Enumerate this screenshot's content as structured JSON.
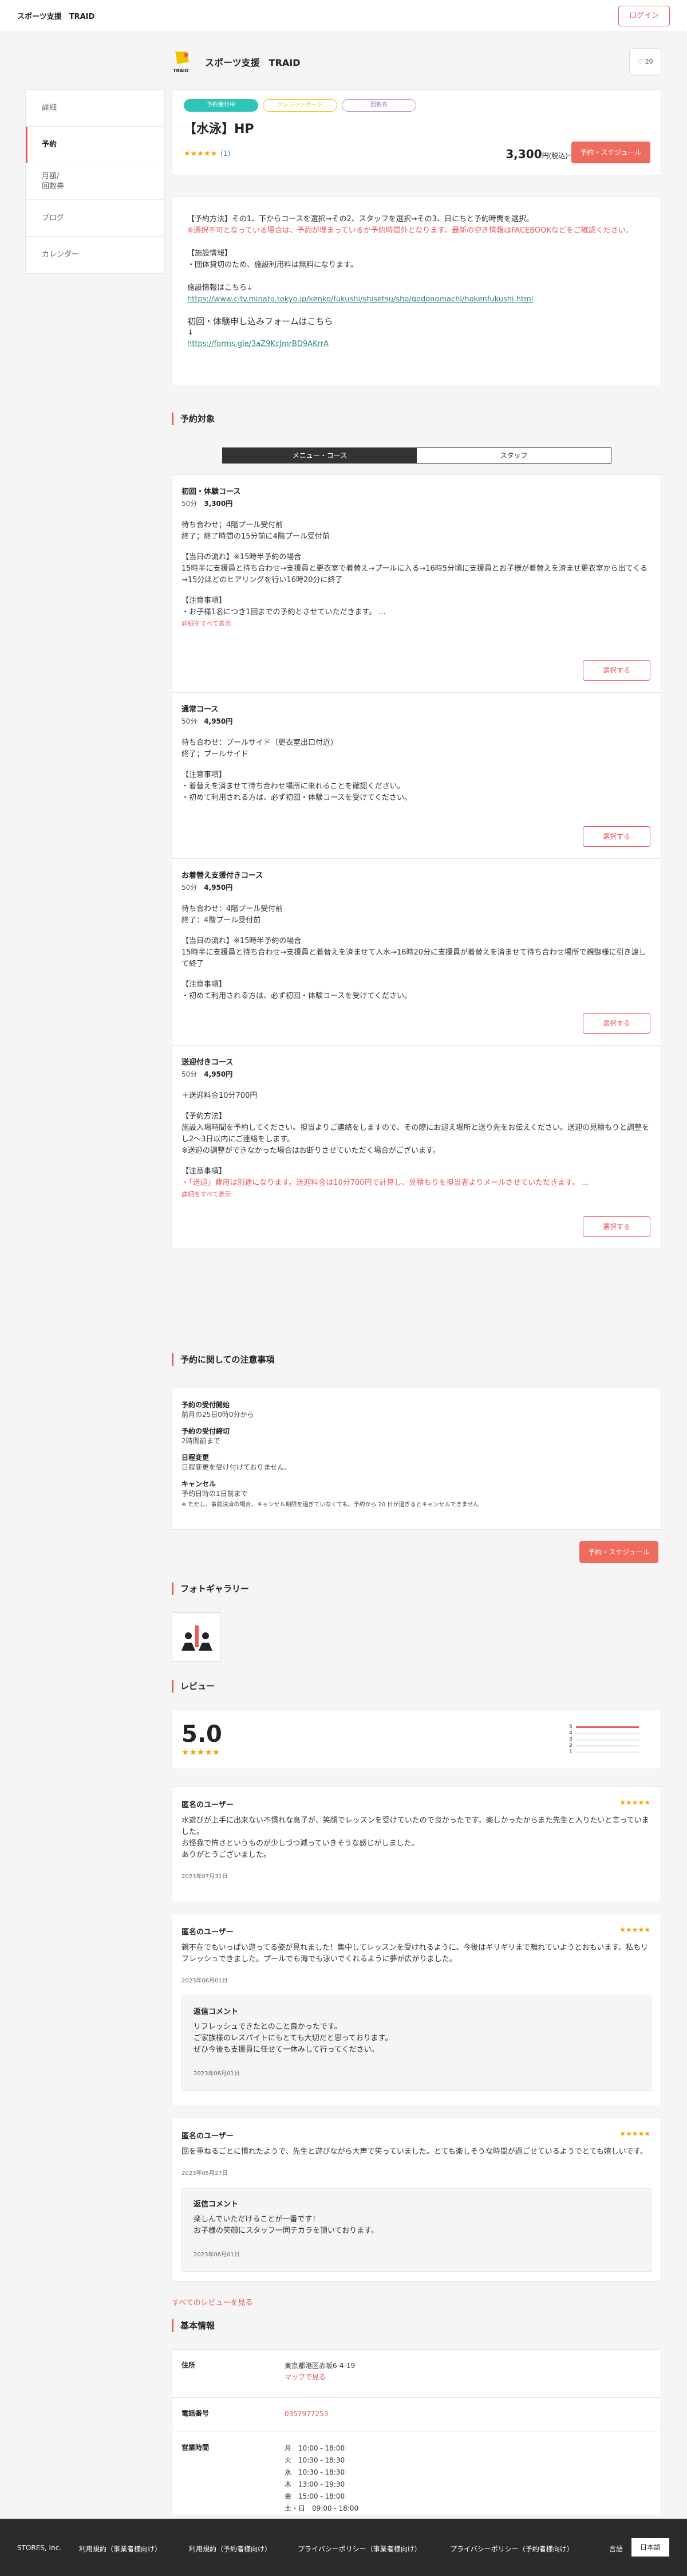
{
  "header": {
    "brand": "スポーツ支援　TRAID",
    "login": "ログイン"
  },
  "store": {
    "name": "スポーツ支援　TRAID",
    "logo_text": "TRAID",
    "fav_count": "20"
  },
  "sidebar": {
    "items": [
      {
        "label": "詳細"
      },
      {
        "label": "予約"
      },
      {
        "label": "月額/\n回数券"
      },
      {
        "label": "ブログ"
      },
      {
        "label": "カレンダー"
      }
    ]
  },
  "summary": {
    "tags": [
      "予約受付中",
      "クレジットカード",
      "回数券"
    ],
    "title": "【水泳】HP",
    "stars": "★★★★★",
    "count": "(1)",
    "price": "3,300",
    "price_unit": "円(税込)〜",
    "reserve": "予約・スケジュール"
  },
  "info": {
    "p1": "【予約方法】その1、下からコースを選択→その2、スタッフを選択→その3、日にちと予約時間を選択。",
    "p2": "※選択不可となっている場合は、予約が埋まっているか予約時間外となります。最新の空き情報はFACEBOOKなどをご確認ください。",
    "p3": "【施設情報】",
    "p4": "・団体貸切のため、施設利用料は無料になります。",
    "p5": "施設情報はこちら↓",
    "link1": "https://www.city.minato.tokyo.jp/kenko/fukushi/shisetsu/sho/godonomachi/hokenfukushi.html",
    "p6": "初回・体験申し込みフォームはこちら",
    "p7": "↓",
    "link2": "https://forms.gle/3aZ9KcJmrBD9AKrrA"
  },
  "sections": {
    "reserve_target": "予約対象",
    "notes": "予約に関しての注意事項",
    "gallery": "フォトギャラリー",
    "review": "レビュー",
    "basic": "基本情報"
  },
  "toggle": {
    "left": "メニュー・コース",
    "right": "スタッフ"
  },
  "menus": [
    {
      "name": "初回・体験コース",
      "duration": "50分",
      "price": "3,300円",
      "lines": [
        "待ち合わせ；4階プール受付前",
        "終了；終了時間の15分前に4階プール受付前",
        "",
        "【当日の流れ】※15時半予約の場合",
        "15時半に支援員と待ち合わせ→支援員と更衣室で着替え→プールに入る→16時5分頃に支援員とお子様が着替えを済ませ更衣室から出てくる→15分ほどのヒアリングを行い16時20分に終了",
        "",
        "【注意事項】",
        "・お子様1名につき1回までの予約とさせていただきます。 ..."
      ],
      "more": "詳細をすべて表示",
      "button": "選択する"
    },
    {
      "name": "通常コース",
      "duration": "50分",
      "price": "4,950円",
      "lines": [
        "待ち合わせ：プールサイド（更衣室出口付近）",
        "終了；プールサイド",
        "",
        "【注意事項】",
        "・着替えを済ませて待ち合わせ場所に来れることを確認ください。",
        "・初めて利用される方は、必ず初回・体験コースを受けてください。"
      ],
      "more": "",
      "button": "選択する"
    },
    {
      "name": "お着替え支援付きコース",
      "duration": "50分",
      "price": "4,950円",
      "lines": [
        "待ち合わせ：4階プール受付前",
        "終了：4階プール受付前",
        "",
        "【当日の流れ】※15時半予約の場合",
        "15時半に支援員と待ち合わせ→支援員と着替えを済ませて入水→16時20分に支援員が着替えを済ませて待ち合わせ場所で親御様に引き渡して終了",
        "",
        "【注意事項】",
        "・初めて利用される方は、必ず初回・体験コースを受けてください。"
      ],
      "more": "",
      "button": "選択する"
    },
    {
      "name": "送迎付きコース",
      "duration": "50分",
      "price": "4,950円",
      "lines": [
        "＋送迎料金10分700円",
        "",
        "【予約方法】",
        "施設入場時間を予約してください。担当よりご連絡をしますので、その際にお迎え場所と送り先をお伝えください。送迎の見積もりと調整をし2〜3日以内にご連絡をします。",
        "※送迎の調整ができなかった場合はお断りさせていただく場合がございます。",
        "",
        "【注意事項】",
        "・「送迎」費用は別途になります。送迎料金は10分700円で計算し、見積もりを担当者よりメールさせていただきます。 ..."
      ],
      "more": "詳細をすべて表示",
      "button": "選択する"
    }
  ],
  "notes": {
    "items": [
      {
        "h": "予約の受付開始",
        "v": "前月の25日0時0分から"
      },
      {
        "h": "予約の受付締切",
        "v": "2時間前まで"
      },
      {
        "h": "日程変更",
        "v": "日程変更を受け付けておりません。"
      },
      {
        "h": "キャンセル",
        "v": "予約日時の1日前まで"
      }
    ],
    "small": "※ ただし、事前決済の場合、キャンセル期限を過ぎていなくても、予約から 20 日が過ぎるとキャンセルできません",
    "button": "予約・スケジュール"
  },
  "review_summary": {
    "score": "5.0",
    "stars": "★★★★★",
    "bars": [
      {
        "label": "5",
        "value": 1
      },
      {
        "label": "4",
        "value": 0
      },
      {
        "label": "3",
        "value": 0
      },
      {
        "label": "2",
        "value": 0
      },
      {
        "label": "1",
        "value": 0
      }
    ]
  },
  "reviews": [
    {
      "who": "匿名のユーザー",
      "stars": "★★★★★",
      "body": "水遊びが上手に出来ない不慣れな息子が、笑顔でレッスンを受けていたので良かったです。楽しかったからまた先生と入りたいと言っていました。\nお怪我で怖さというものが少しづつ減っていきそうな感じがしました。\nありがとうございました。",
      "date": "2023年07月31日",
      "reply": null
    },
    {
      "who": "匿名のユーザー",
      "stars": "★★★★★",
      "body": "親不在でもいっぱい遊ってる姿が見れました！集中してレッスンを受けれるように、今後はギリギリまで離れていようとおもいます。私もリフレッシュできました。プールでも海でも泳いでくれるように夢が広がりました。",
      "date": "2023年06月01日",
      "reply": {
        "title": "返信コメント",
        "body": "リフレッシュできたとのこと良かったです。\nご家族様のレスパイトにもとても大切だと思っております。\nぜひ今後も支援員に任せて一休みして行ってください。",
        "date": "2023年06月01日"
      }
    },
    {
      "who": "匿名のユーザー",
      "stars": "★★★★★",
      "body": "回を重ねるごとに慣れたようで、先生と遊びながら大声で笑っていました。とても楽しそうな時間が過ごせているようでとても嬉しいです。",
      "date": "2023年05月27日",
      "reply": {
        "title": "返信コメント",
        "body": "楽しんでいただけることが一番です！\nお子様の笑顔にスタッフ一同テカラを頂いております。",
        "date": "2023年06月01日"
      }
    }
  ],
  "all_reviews": "すべてのレビューを見る",
  "basic": {
    "address_k": "住所",
    "address": "東京都港区赤坂6-4-19",
    "map": "マップで見る",
    "phone_k": "電話番号",
    "phone": "0357977253",
    "hours_k": "営業時間",
    "hours": [
      "月　10:00 - 18:00",
      "火　10:30 - 18:30",
      "水　10:30 - 18:30",
      "木　13:00 - 19:30",
      "金　15:00 - 18:00",
      "土・日　09:00 - 18:00"
    ]
  },
  "footer": {
    "company": "STORES, Inc.",
    "links": [
      "利用規約（事業者様向け）",
      "利用規約（予約者様向け）",
      "プライバシーポリシー（事業者様向け）",
      "プライバシーポリシー（予約者様向け）"
    ],
    "lang_label": "言語",
    "lang": "日本語"
  },
  "colors": {
    "accent": "#e95a5a",
    "teal": "#2ec4b6",
    "star": "#f0a500",
    "footer": "#2b2b2b"
  }
}
